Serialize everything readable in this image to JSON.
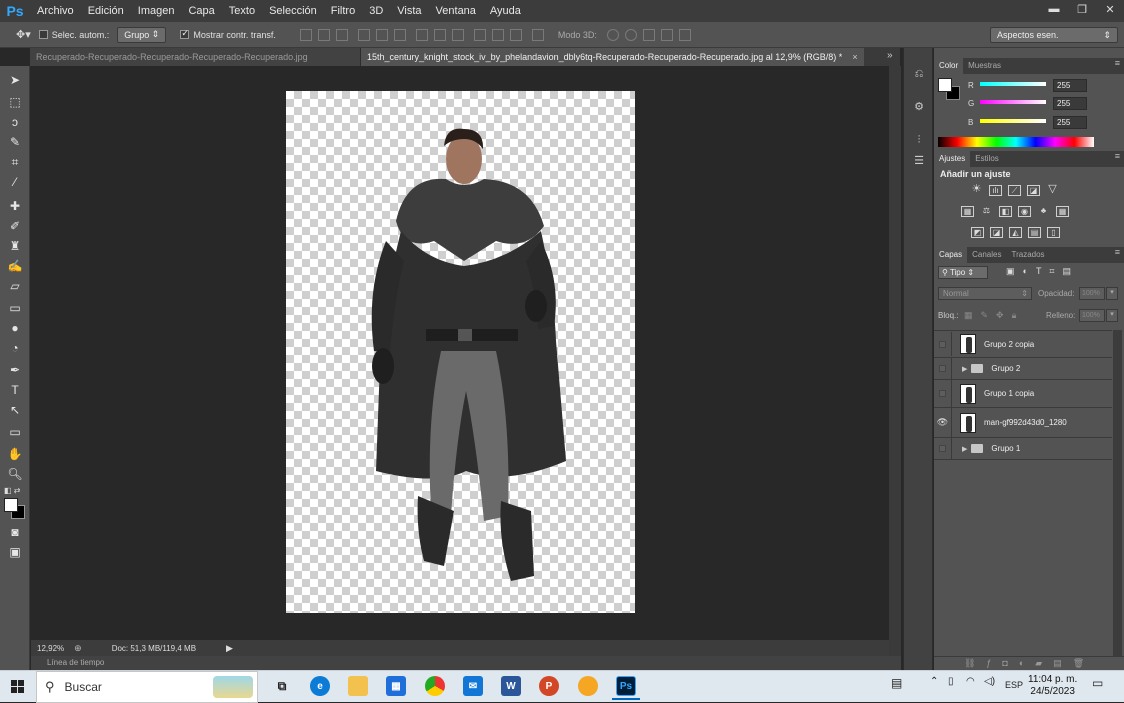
{
  "app": {
    "logo": "Ps"
  },
  "menu": [
    "Archivo",
    "Edición",
    "Imagen",
    "Capa",
    "Texto",
    "Selección",
    "Filtro",
    "3D",
    "Vista",
    "Ventana",
    "Ayuda"
  ],
  "options": {
    "auto_select_label": "Selec. autom.:",
    "auto_select_value": "Grupo",
    "show_transform_label": "Mostrar contr. transf.",
    "mode3d_label": "Modo 3D:",
    "workspace": "Aspectos esen."
  },
  "tabs": [
    {
      "label": "Recuperado-Recuperado-Recuperado-Recuperado-Recuperado.jpg"
    },
    {
      "label": "15th_century_knight_stock_iv_by_phelandavion_dbly6tq-Recuperado-Recuperado-Recuperado.jpg al 12,9% (RGB/8) *"
    }
  ],
  "status": {
    "zoom": "12,92%",
    "doc": "Doc: 51,3 MB/119,4 MB",
    "timeline": "Línea de tiempo"
  },
  "color_panel": {
    "tabs": [
      "Color",
      "Muestras"
    ],
    "channels": [
      {
        "label": "R",
        "value": "255",
        "color": "#00c8d8"
      },
      {
        "label": "G",
        "value": "255",
        "color": "#e040e0"
      },
      {
        "label": "B",
        "value": "255",
        "color": "#f0f000"
      }
    ]
  },
  "adjust_panel": {
    "tabs": [
      "Ajustes",
      "Estilos"
    ],
    "title": "Añadir un ajuste"
  },
  "layers_panel": {
    "tabs": [
      "Capas",
      "Canales",
      "Trazados"
    ],
    "filter": "Tipo",
    "blend": "Normal",
    "opacity_label": "Opacidad:",
    "opacity_value": "100%",
    "lock_label": "Bloq.:",
    "fill_label": "Relleno:",
    "fill_value": "100%",
    "layers": [
      {
        "name": "Grupo 2 copia",
        "type": "layer",
        "visible": false
      },
      {
        "name": "Grupo 2",
        "type": "group",
        "visible": false
      },
      {
        "name": "Grupo 1 copia",
        "type": "layer",
        "visible": false
      },
      {
        "name": "man-gf992d43d0_1280",
        "type": "layer",
        "visible": true
      },
      {
        "name": "Grupo 1",
        "type": "group",
        "visible": false
      }
    ]
  },
  "taskbar": {
    "search_placeholder": "Buscar",
    "lang": "ESP",
    "time": "11:04 p. m.",
    "date": "24/5/2023"
  }
}
